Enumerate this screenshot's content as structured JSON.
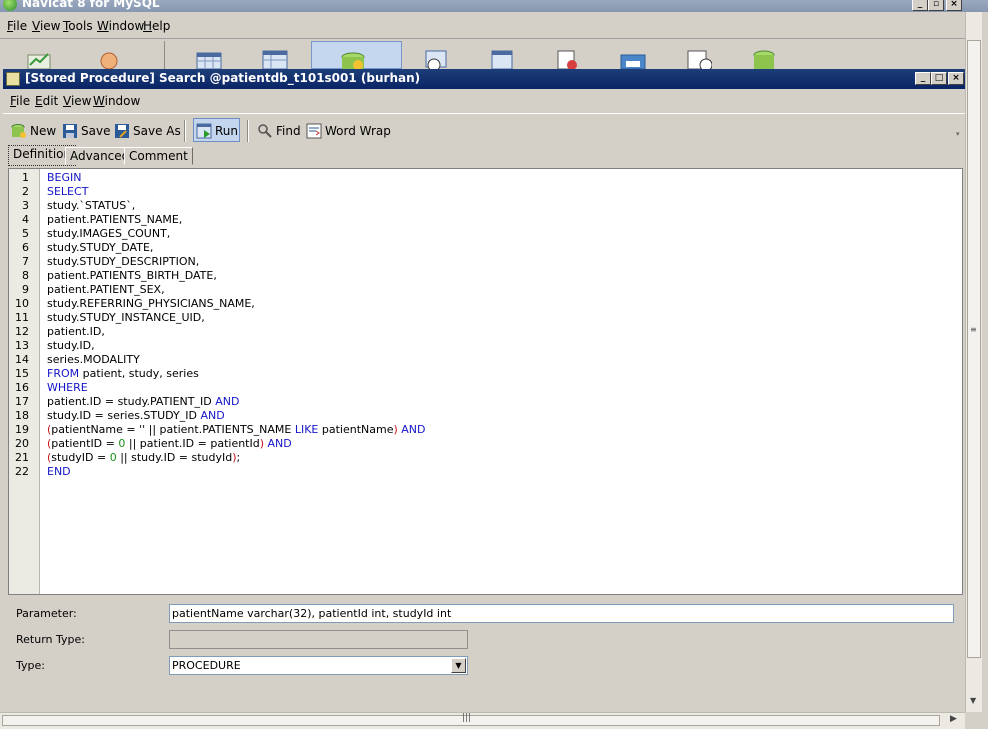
{
  "app": {
    "title": "Navicat 8 for MySQL",
    "menu": [
      {
        "label": "File",
        "accel": "F",
        "rest": "ile"
      },
      {
        "label": "View",
        "accel": "V",
        "rest": "iew"
      },
      {
        "label": "Tools",
        "accel": "T",
        "rest": "ools"
      },
      {
        "label": "Window",
        "accel": "W",
        "rest": "indow"
      },
      {
        "label": "Help",
        "accel": "H",
        "rest": "elp"
      }
    ],
    "toolbar_icons": [
      "connection-icon",
      "user-icon",
      "table-icon",
      "view-icon",
      "procedure-icon",
      "event-icon",
      "query-icon",
      "report-icon",
      "backup-icon",
      "schedule-icon",
      "model-icon"
    ]
  },
  "window": {
    "title": "[Stored Procedure] Search @patientdb_t101s001 (burhan)",
    "menu": [
      {
        "label": "File",
        "accel": "F",
        "rest": "ile"
      },
      {
        "label": "Edit",
        "accel": "E",
        "rest": "dit"
      },
      {
        "label": "View",
        "accel": "V",
        "rest": "iew"
      },
      {
        "label": "Window",
        "accel": "W",
        "rest": "indow"
      }
    ],
    "toolbar": {
      "new": "New",
      "save": "Save",
      "save_as": "Save As",
      "run": "Run",
      "find": "Find",
      "word_wrap": "Word Wrap"
    },
    "tabs": [
      "Definition",
      "Advanced",
      "Comment"
    ],
    "active_tab": "Definition"
  },
  "editor": {
    "lines": [
      [
        {
          "t": "BEGIN",
          "c": "kw"
        }
      ],
      [
        {
          "t": "SELECT",
          "c": "kw"
        }
      ],
      [
        {
          "t": "study.`STATUS`,",
          "c": ""
        }
      ],
      [
        {
          "t": "patient.PATIENTS_NAME,",
          "c": ""
        }
      ],
      [
        {
          "t": "study.IMAGES_COUNT,",
          "c": ""
        }
      ],
      [
        {
          "t": "study.STUDY_DATE,",
          "c": ""
        }
      ],
      [
        {
          "t": "study.STUDY_DESCRIPTION,",
          "c": ""
        }
      ],
      [
        {
          "t": "patient.PATIENTS_BIRTH_DATE,",
          "c": ""
        }
      ],
      [
        {
          "t": "patient.PATIENT_SEX,",
          "c": ""
        }
      ],
      [
        {
          "t": "study.REFERRING_PHYSICIANS_NAME,",
          "c": ""
        }
      ],
      [
        {
          "t": "study.STUDY_INSTANCE_UID,",
          "c": ""
        }
      ],
      [
        {
          "t": "patient.ID,",
          "c": ""
        }
      ],
      [
        {
          "t": "study.ID,",
          "c": ""
        }
      ],
      [
        {
          "t": "series.MODALITY",
          "c": ""
        }
      ],
      [
        {
          "t": "FROM",
          "c": "kw"
        },
        {
          "t": " patient, study, series",
          "c": ""
        }
      ],
      [
        {
          "t": "WHERE",
          "c": "kw"
        }
      ],
      [
        {
          "t": "patient.ID = study.PATIENT_ID ",
          "c": ""
        },
        {
          "t": "AND",
          "c": "kw"
        }
      ],
      [
        {
          "t": "study.ID = series.STUDY_ID ",
          "c": ""
        },
        {
          "t": "AND",
          "c": "kw"
        }
      ],
      [
        {
          "t": "(",
          "c": "op"
        },
        {
          "t": "patientName = '' || patient.PATIENTS_NAME ",
          "c": ""
        },
        {
          "t": "LIKE",
          "c": "kw"
        },
        {
          "t": " patientName",
          "c": ""
        },
        {
          "t": ")",
          "c": "op"
        },
        {
          "t": " ",
          "c": ""
        },
        {
          "t": "AND",
          "c": "kw"
        }
      ],
      [
        {
          "t": "(",
          "c": "op"
        },
        {
          "t": "patientID = ",
          "c": ""
        },
        {
          "t": "0",
          "c": "num"
        },
        {
          "t": " || patient.ID = patientId",
          "c": ""
        },
        {
          "t": ")",
          "c": "op"
        },
        {
          "t": " ",
          "c": ""
        },
        {
          "t": "AND",
          "c": "kw"
        }
      ],
      [
        {
          "t": "(",
          "c": "op"
        },
        {
          "t": "studyID = ",
          "c": ""
        },
        {
          "t": "0",
          "c": "num"
        },
        {
          "t": " || study.ID = studyId",
          "c": ""
        },
        {
          "t": ")",
          "c": "op"
        },
        {
          "t": ";",
          "c": ""
        }
      ],
      [
        {
          "t": "END",
          "c": "kw"
        }
      ]
    ]
  },
  "form": {
    "parameter_label": "Parameter:",
    "parameter_value": "patientName varchar(32), patientId int, studyId int",
    "return_type_label": "Return Type:",
    "return_type_value": "",
    "type_label": "Type:",
    "type_value": "PROCEDURE"
  }
}
